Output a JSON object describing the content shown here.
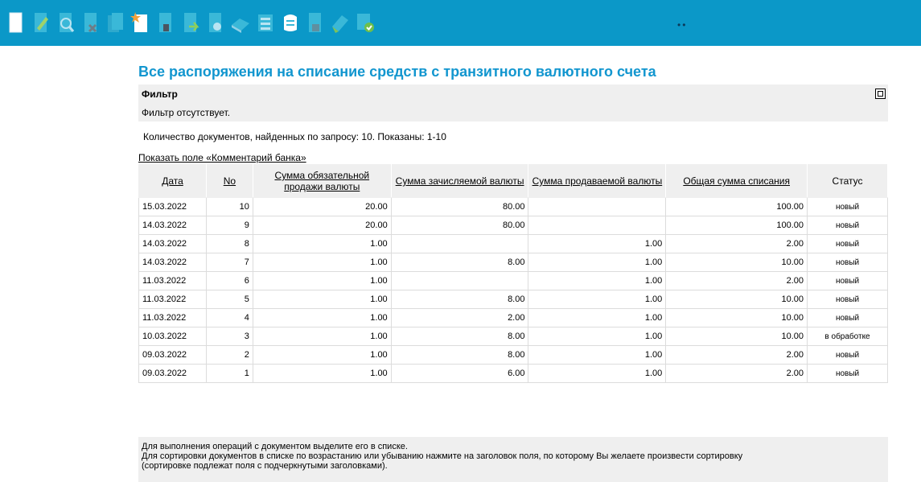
{
  "toolbar": {
    "buttons": [
      {
        "name": "new-document-icon"
      },
      {
        "name": "edit-document-icon"
      },
      {
        "name": "view-document-icon"
      },
      {
        "name": "delete-document-icon"
      },
      {
        "name": "copy-document-icon"
      },
      {
        "name": "create-from-template-icon"
      },
      {
        "name": "sign-document-icon"
      },
      {
        "name": "send-document-icon"
      },
      {
        "name": "check-document-icon"
      },
      {
        "name": "print-icon"
      },
      {
        "name": "export-icon"
      },
      {
        "name": "scroll-icon"
      },
      {
        "name": "archive-icon"
      },
      {
        "name": "stamp-icon"
      },
      {
        "name": "approve-document-icon"
      }
    ],
    "dots": "••"
  },
  "page": {
    "title": "Все распоряжения на списание средств с транзитного валютного счета"
  },
  "filter": {
    "title": "Фильтр",
    "text": "Фильтр отсутствует."
  },
  "summary": {
    "count_text": "Количество  документов, найденных по запросу: 10.  Показаны:  1-10",
    "show_comment_link": "Показать поле «Комментарий банка»"
  },
  "table": {
    "headers": {
      "date": "Дата",
      "no": "No",
      "mandatory_sale": "Сумма обязательной продажи валюты",
      "credited": "Сумма зачисляемой валюты",
      "sold": "Сумма продаваемой валюты",
      "total": "Общая сумма списания",
      "status": "Статус"
    },
    "rows": [
      {
        "date": "15.03.2022",
        "no": "10",
        "mandatory": "20.00",
        "credited": "80.00",
        "sold": "",
        "total": "100.00",
        "status": "новый"
      },
      {
        "date": "14.03.2022",
        "no": "9",
        "mandatory": "20.00",
        "credited": "80.00",
        "sold": "",
        "total": "100.00",
        "status": "новый"
      },
      {
        "date": "14.03.2022",
        "no": "8",
        "mandatory": "1.00",
        "credited": "",
        "sold": "1.00",
        "total": "2.00",
        "status": "новый"
      },
      {
        "date": "14.03.2022",
        "no": "7",
        "mandatory": "1.00",
        "credited": "8.00",
        "sold": "1.00",
        "total": "10.00",
        "status": "новый"
      },
      {
        "date": "11.03.2022",
        "no": "6",
        "mandatory": "1.00",
        "credited": "",
        "sold": "1.00",
        "total": "2.00",
        "status": "новый"
      },
      {
        "date": "11.03.2022",
        "no": "5",
        "mandatory": "1.00",
        "credited": "8.00",
        "sold": "1.00",
        "total": "10.00",
        "status": "новый"
      },
      {
        "date": "11.03.2022",
        "no": "4",
        "mandatory": "1.00",
        "credited": "2.00",
        "sold": "1.00",
        "total": "10.00",
        "status": "новый"
      },
      {
        "date": "10.03.2022",
        "no": "3",
        "mandatory": "1.00",
        "credited": "8.00",
        "sold": "1.00",
        "total": "10.00",
        "status": "в обработке"
      },
      {
        "date": "09.03.2022",
        "no": "2",
        "mandatory": "1.00",
        "credited": "8.00",
        "sold": "1.00",
        "total": "2.00",
        "status": "новый"
      },
      {
        "date": "09.03.2022",
        "no": "1",
        "mandatory": "1.00",
        "credited": "6.00",
        "sold": "1.00",
        "total": "2.00",
        "status": "новый"
      }
    ]
  },
  "help": {
    "line1": "Для выполнения операций с документом выделите его в списке.",
    "line2": "Для сортировки документов в списке по возрастанию или убыванию нажмите на заголовок поля, по которому Вы желаете произвести сортировку",
    "line3": "(сортировке подлежат поля с подчеркнутыми заголовками)."
  },
  "colors": {
    "toolbar_bg": "#0b98c8",
    "title": "#1296cf",
    "panel_bg": "#efefef"
  }
}
